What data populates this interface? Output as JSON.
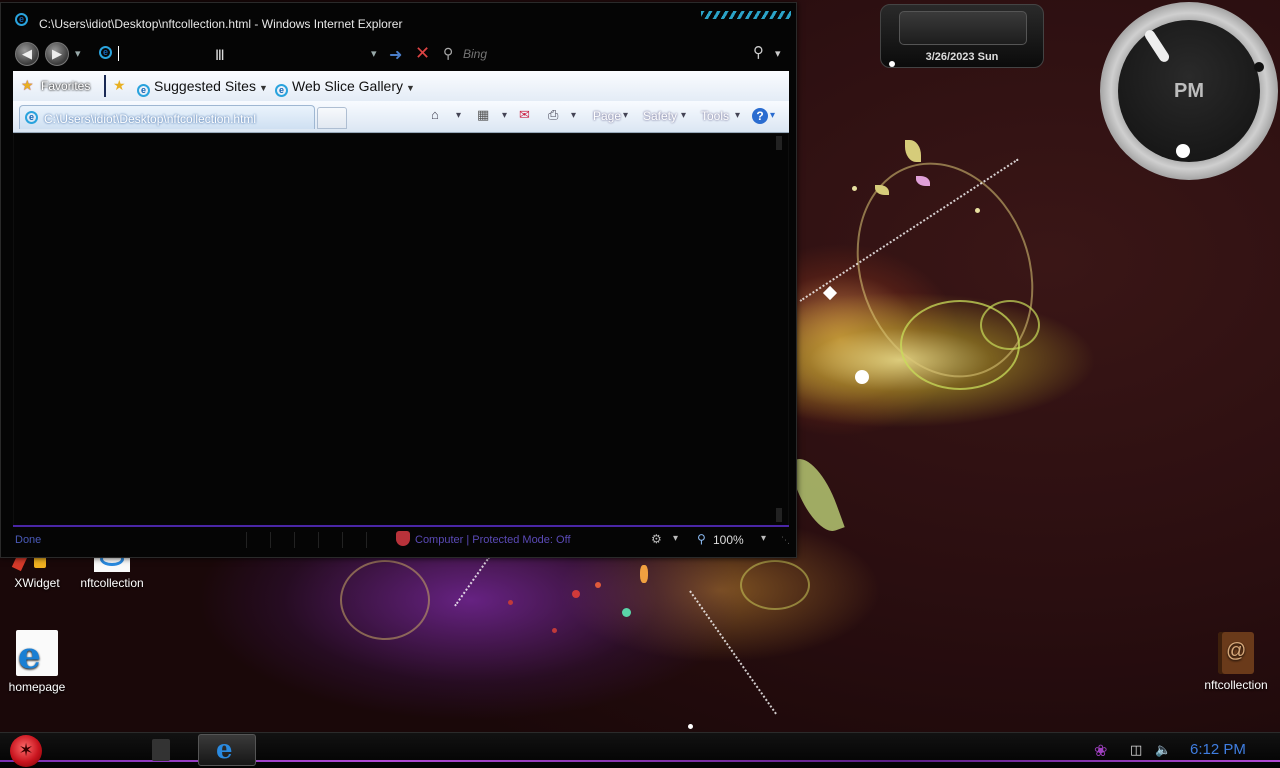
{
  "window": {
    "title": "C:\\Users\\idiot\\Desktop\\nftcollection.html - Windows Internet Explorer",
    "address_value": "",
    "search_placeholder": "Bing"
  },
  "favorites_bar": {
    "favorites_label": "Favorites",
    "items": [
      {
        "label": "Suggested Sites"
      },
      {
        "label": "Web Slice Gallery"
      }
    ]
  },
  "tabs": [
    {
      "label": "C:\\Users\\idiot\\Desktop\\nftcollection.html"
    }
  ],
  "command_bar": {
    "page_label": "Page",
    "safety_label": "Safety",
    "tools_label": "Tools"
  },
  "status_bar": {
    "status_text": "Done",
    "zone_text": "Computer | Protected Mode: Off",
    "zoom_text": "100%"
  },
  "gadgets": {
    "date_text": "3/26/2023 Sun",
    "clock_ampm": "PM"
  },
  "desktop_icons": [
    {
      "label": "XWidget"
    },
    {
      "label": "nftcollection"
    },
    {
      "label": "homepage"
    },
    {
      "label": "nftcollection"
    }
  ],
  "taskbar": {
    "clock_time": "6:12 PM"
  },
  "colors": {
    "accent_purple": "#4a26a6",
    "clock_blue": "#3f7de0",
    "start_red": "#c8141e"
  }
}
